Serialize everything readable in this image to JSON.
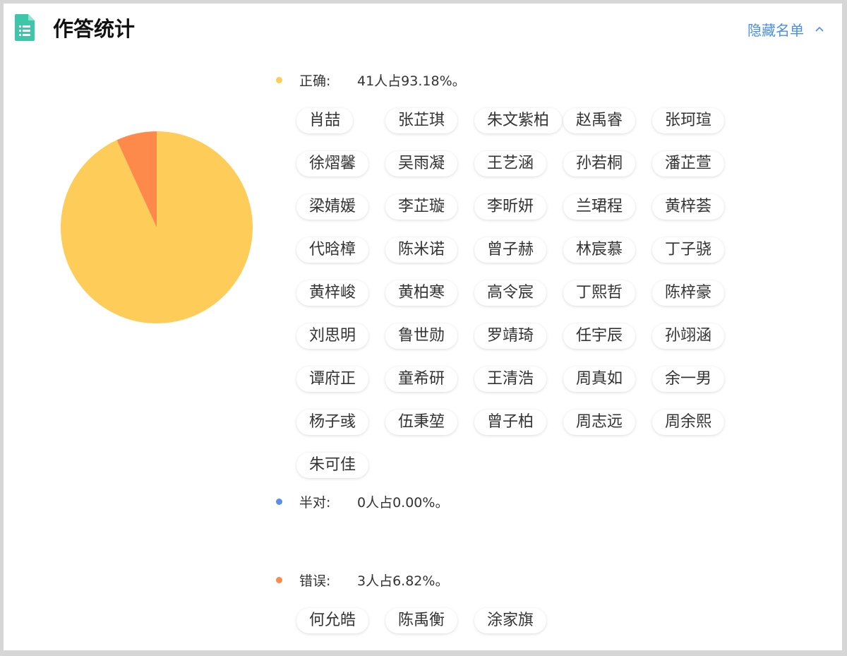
{
  "header": {
    "title": "作答统计",
    "toggle_label": "隐藏名单"
  },
  "colors": {
    "correct": "#fecd59",
    "half": "#5b8fe6",
    "wrong": "#fd8a4b",
    "accent": "#4a90e2",
    "icon": "#3ec6a8"
  },
  "chart_data": {
    "type": "pie",
    "labels": [
      "正确",
      "半对",
      "错误"
    ],
    "values": [
      41,
      0,
      3
    ],
    "percents": [
      93.18,
      0.0,
      6.82
    ]
  },
  "categories": [
    {
      "label": "正确:",
      "summary": "41人占93.18%。",
      "students": [
        "肖喆",
        "张芷琪",
        "朱文紫柏",
        "赵禹睿",
        "张珂瑄",
        "徐熠馨",
        "吴雨凝",
        "王艺涵",
        "孙若桐",
        "潘芷萱",
        "梁婧媛",
        "李芷璇",
        "李昕妍",
        "兰珺程",
        "黄梓荟",
        "代晗樟",
        "陈米诺",
        "曾子赫",
        "林宸慕",
        "丁子骁",
        "黄梓峻",
        "黄柏寒",
        "高令宸",
        "丁熙哲",
        "陈梓豪",
        "刘思明",
        "鲁世勋",
        "罗靖琦",
        "任宇辰",
        "孙翊涵",
        "谭府正",
        "童希研",
        "王清浩",
        "周真如",
        "余一男",
        "杨子彧",
        "伍秉堃",
        "曾子柏",
        "周志远",
        "周余熙",
        "朱可佳"
      ]
    },
    {
      "label": "半对:",
      "summary": "0人占0.00%。",
      "students": []
    },
    {
      "label": "错误:",
      "summary": "3人占6.82%。",
      "students": [
        "何允皓",
        "陈禹衡",
        "涂家旗"
      ]
    }
  ]
}
